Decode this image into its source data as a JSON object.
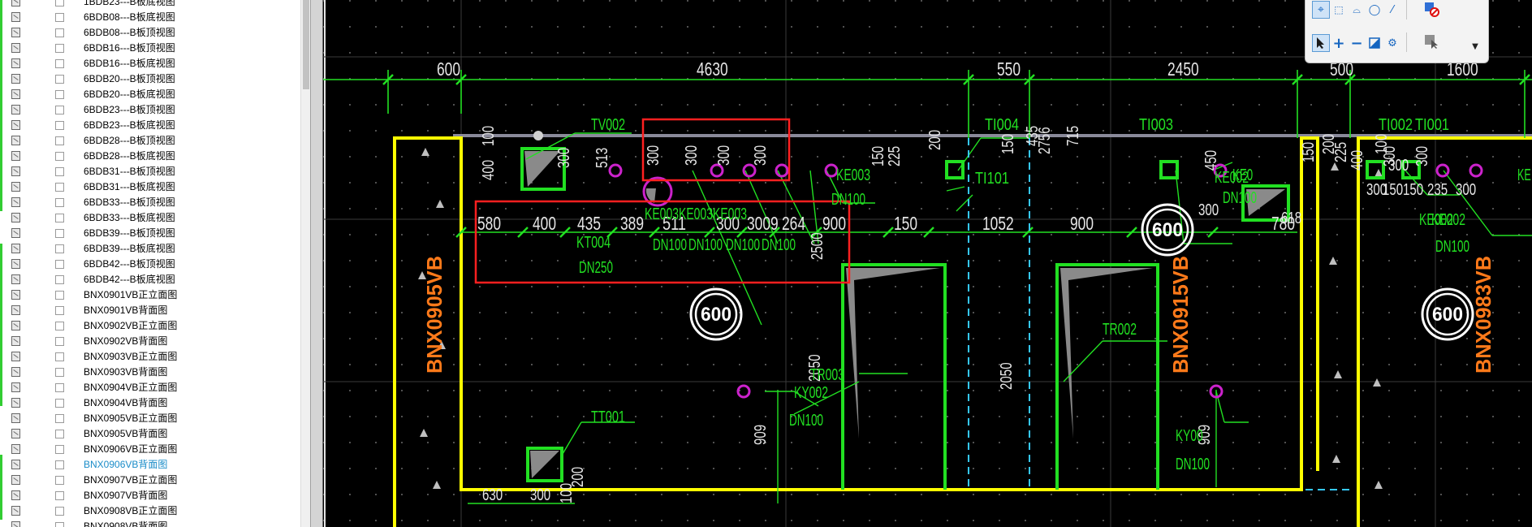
{
  "layer_tree": {
    "items": [
      {
        "label": "1BDB23---B板底视图",
        "selected": false
      },
      {
        "label": "6BDB08---B板底视图",
        "selected": false
      },
      {
        "label": "6BDB08---B板顶视图",
        "selected": false
      },
      {
        "label": "6BDB16---B板顶视图",
        "selected": false
      },
      {
        "label": "6BDB16---B板底视图",
        "selected": false
      },
      {
        "label": "6BDB20---B板顶视图",
        "selected": false
      },
      {
        "label": "6BDB20---B板底视图",
        "selected": false
      },
      {
        "label": "6BDB23---B板顶视图",
        "selected": false
      },
      {
        "label": "6BDB23---B板底视图",
        "selected": false
      },
      {
        "label": "6BDB28---B板顶视图",
        "selected": false
      },
      {
        "label": "6BDB28---B板底视图",
        "selected": false
      },
      {
        "label": "6BDB31---B板顶视图",
        "selected": false
      },
      {
        "label": "6BDB31---B板底视图",
        "selected": false
      },
      {
        "label": "6BDB33---B板顶视图",
        "selected": false
      },
      {
        "label": "6BDB33---B板底视图",
        "selected": false
      },
      {
        "label": "6BDB39---B板顶视图",
        "selected": false
      },
      {
        "label": "6BDB39---B板底视图",
        "selected": false
      },
      {
        "label": "6BDB42---B板顶视图",
        "selected": false
      },
      {
        "label": "6BDB42---B板底视图",
        "selected": false
      },
      {
        "label": "BNX0901VB正立面图",
        "selected": false
      },
      {
        "label": "BNX0901VB背面图",
        "selected": false
      },
      {
        "label": "BNX0902VB正立面图",
        "selected": false
      },
      {
        "label": "BNX0902VB背面图",
        "selected": false
      },
      {
        "label": "BNX0903VB正立面图",
        "selected": false
      },
      {
        "label": "BNX0903VB背面图",
        "selected": false
      },
      {
        "label": "BNX0904VB正立面图",
        "selected": false
      },
      {
        "label": "BNX0904VB背面图",
        "selected": false
      },
      {
        "label": "BNX0905VB正立面图",
        "selected": false
      },
      {
        "label": "BNX0905VB背面图",
        "selected": false
      },
      {
        "label": "BNX0906VB正立面图",
        "selected": false
      },
      {
        "label": "BNX0906VB背面图",
        "selected": true
      },
      {
        "label": "BNX0907VB正立面图",
        "selected": false
      },
      {
        "label": "BNX0907VB背面图",
        "selected": false
      },
      {
        "label": "BNX0908VB正立面图",
        "selected": false
      },
      {
        "label": "BNX0908VB背面图",
        "selected": false
      }
    ]
  },
  "toolbar": {
    "icons_row1": [
      "crosshair-select-icon",
      "rect-select-icon",
      "lasso-select-icon",
      "circle-select-icon",
      "line-select-icon",
      "layer-off-icon"
    ],
    "icons_row2": [
      "pointer-select-icon",
      "add-select-icon",
      "remove-select-icon",
      "invert-select-icon",
      "settings-select-icon",
      "pointer-gray-icon",
      "dropdown-icon"
    ]
  },
  "drawing": {
    "colors": {
      "background": "#000000",
      "outline": "#ffff00",
      "geometry": "#22e022",
      "annotation": "#22e022",
      "panel_label": "#ff7a1a",
      "markup": "#ff2020",
      "point": "#cc22cc",
      "centerline": "#35c8ff",
      "circle_tag": "#ffffff"
    },
    "panel_labels": [
      "BNX0905VB",
      "BNX0915VB",
      "BNX0983VB"
    ],
    "circle_tags": [
      "600",
      "600",
      "600"
    ],
    "top_dimensions": [
      "600",
      "4630",
      "550",
      "2450",
      "500",
      "1600"
    ],
    "second_dimensions": [
      "580",
      "400",
      "435",
      "389",
      "511",
      "300",
      "3009",
      "264",
      "900",
      "150",
      "1052",
      "900",
      "780"
    ],
    "side_dimensions": [
      "400",
      "100",
      "300",
      "513",
      "300",
      "300",
      "300",
      "300",
      "200",
      "150",
      "225",
      "2756",
      "150",
      "435",
      "715",
      "450",
      "400",
      "100",
      "200",
      "150",
      "225",
      "300",
      "300",
      "2500",
      "2050",
      "2050",
      "909",
      "909",
      "300",
      "300",
      "300",
      "150",
      "150",
      "235",
      "300",
      "618"
    ],
    "bottom_dimensions": [
      "630",
      "300",
      "100",
      "200"
    ],
    "callouts": [
      "TV002",
      "TI004",
      "TI003",
      "TI002",
      "TI001",
      "TI101",
      "KE003",
      "DN100",
      "KE002",
      "KT004",
      "DN250",
      "KE003KE003KE003",
      "DN100",
      "DN100",
      "DN100",
      "DN100",
      "KE002",
      "DN100",
      "KY002",
      "DN100",
      "TR003",
      "TR002",
      "KY00",
      "DN100",
      "TT001",
      "KE002",
      "DN100",
      "KE0",
      "KE"
    ]
  }
}
